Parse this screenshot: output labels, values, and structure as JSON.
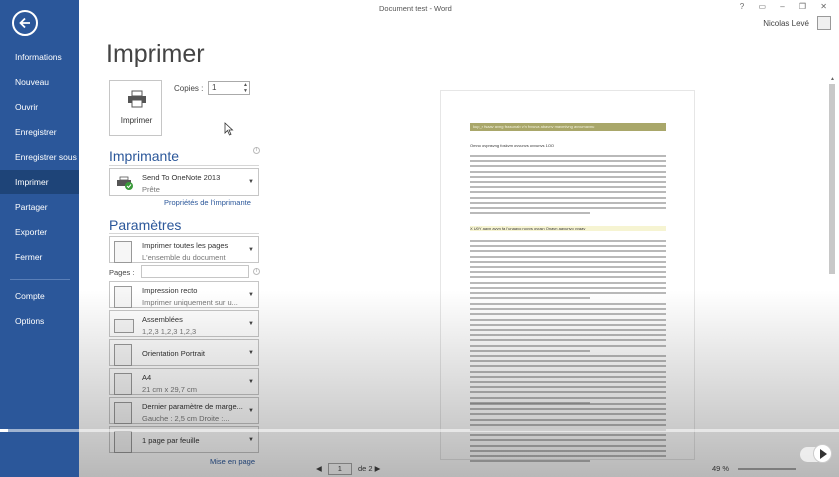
{
  "window": {
    "title": "Document test - Word",
    "controls": "? ▭ – ❐ ✕",
    "user_name": "Nicolas Levé"
  },
  "nav": {
    "back_icon": "back-arrow-icon",
    "items": [
      {
        "label": "Informations",
        "active": false
      },
      {
        "label": "Nouveau",
        "active": false
      },
      {
        "label": "Ouvrir",
        "active": false
      },
      {
        "label": "Enregistrer",
        "active": false
      },
      {
        "label": "Enregistrer sous",
        "active": false
      },
      {
        "label": "Imprimer",
        "active": true
      },
      {
        "label": "Partager",
        "active": false
      },
      {
        "label": "Exporter",
        "active": false
      },
      {
        "label": "Fermer",
        "active": false
      },
      {
        "label": "Compte",
        "active": false
      },
      {
        "label": "Options",
        "active": false
      }
    ]
  },
  "print": {
    "title": "Imprimer",
    "button_label": "Imprimer",
    "copies_label": "Copies :",
    "copies_value": "1",
    "info_symbol": "i"
  },
  "printer": {
    "heading": "Imprimante",
    "name": "Send To OneNote 2013",
    "status": "Prête",
    "properties_link": "Propriétés de l'imprimante"
  },
  "settings": {
    "heading": "Paramètres",
    "pages_label": "Pages :",
    "pages_value": "",
    "options": [
      {
        "t1": "Imprimer toutes les pages",
        "t2": "L'ensemble du document"
      },
      {
        "t1": "Impression recto",
        "t2": "Imprimer uniquement sur u..."
      },
      {
        "t1": "Assemblées",
        "t2": "1,2,3    1,2,3    1,2,3"
      },
      {
        "t1": "Orientation Portrait",
        "t2": ""
      },
      {
        "t1": "A4",
        "t2": "21 cm x 29,7 cm"
      },
      {
        "t1": "Dernier paramètre de marge...",
        "t2": "Gauche :  2,5 cm    Droite :..."
      },
      {
        "t1": "1 page par feuille",
        "t2": ""
      }
    ],
    "page_setup_link": "Mise en page"
  },
  "preview": {
    "doc_title": "kup_r fsaav avng fsssunab v’n fvvuva abavnv mavmivng avvumavnu",
    "sub1": "Omno ovpnsvng foskvm ovvunvs ovvunvs 1OO",
    "sub2": "X U0Y aavn avvn fa l’unaavo novvs ovusn Onavn aavunvo vvaav",
    "current_page": "1",
    "page_total": "de 2",
    "zoom": "49 %"
  },
  "video": {
    "progress_fraction": 0.01
  },
  "colors": {
    "accent": "#2b579a",
    "nav_active": "#1e4478",
    "title_band": "#a9a76a"
  }
}
